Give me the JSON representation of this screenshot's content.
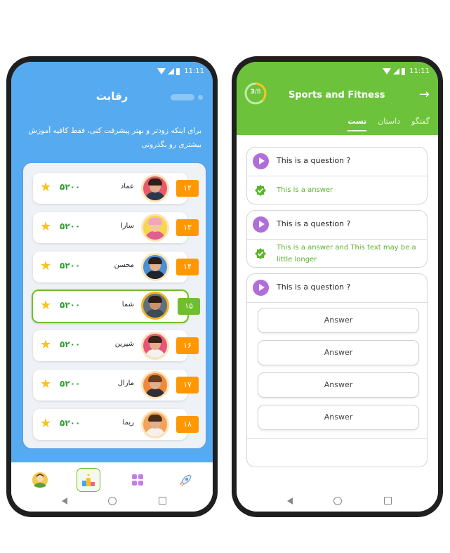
{
  "colors": {
    "left_header": "#56aaf0",
    "right_header": "#6cc23a",
    "rank_orange": "#ff9800",
    "accent_green": "#6fbe2e",
    "play_purple": "#b06ed8"
  },
  "status_bar": {
    "time": "11:11"
  },
  "leaderboard": {
    "title": "رقابت",
    "description": "برای اینکه زودتر و بهتر پیشرفت کنی، فقط کافیه آموزش بیشتری رو بگذرونی",
    "rows": [
      {
        "rank": "۱۲",
        "name": "عماد",
        "score": "۵۲۰۰",
        "highlighted": false
      },
      {
        "rank": "۱۳",
        "name": "سارا",
        "score": "۵۲۰۰",
        "highlighted": false
      },
      {
        "rank": "۱۴",
        "name": "محسن",
        "score": "۵۲۰۰",
        "highlighted": false
      },
      {
        "rank": "۱۵",
        "name": "شما",
        "score": "۵۲۰۰",
        "highlighted": true
      },
      {
        "rank": "۱۶",
        "name": "شیرین",
        "score": "۵۲۰۰",
        "highlighted": false
      },
      {
        "rank": "۱۷",
        "name": "مارال",
        "score": "۵۲۰۰",
        "highlighted": false
      },
      {
        "rank": "۱۸",
        "name": "ریما",
        "score": "۵۲۰۰",
        "highlighted": false
      }
    ],
    "bottom_nav": [
      {
        "icon": "profile-icon"
      },
      {
        "icon": "podium-icon",
        "active": true
      },
      {
        "icon": "grid-icon"
      },
      {
        "icon": "rocket-icon"
      }
    ]
  },
  "quiz": {
    "progress": {
      "current": "3",
      "total": "/8",
      "fraction": 0.375
    },
    "title": "Sports and Fitness",
    "tabs": [
      "گفتگو",
      "داستان",
      "تست"
    ],
    "active_tab": "تست",
    "questions": [
      {
        "question": "This is a question ?",
        "answer": "This is a answer"
      },
      {
        "question": "This is a question ?",
        "answer": "This is a answer and This text may be a little longer"
      },
      {
        "question": "This is a question ?",
        "options": [
          "Answer",
          "Answer",
          "Answer",
          "Answer"
        ]
      }
    ]
  }
}
